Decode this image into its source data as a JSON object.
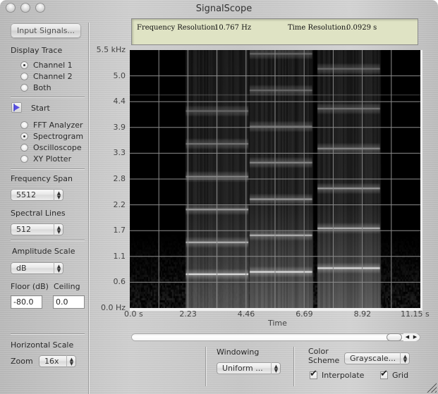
{
  "window": {
    "title": "SignalScope"
  },
  "sidebar": {
    "input_signals_button": "Input Signals...",
    "display_trace": {
      "label": "Display Trace",
      "options": [
        "Channel 1",
        "Channel 2",
        "Both"
      ],
      "selected": "Channel 1"
    },
    "start_button": "Start",
    "mode": {
      "options": [
        "FFT Analyzer",
        "Spectrogram",
        "Oscilloscope",
        "XY Plotter"
      ],
      "selected": "Spectrogram"
    },
    "frequency_span": {
      "label": "Frequency Span",
      "value": "5512"
    },
    "spectral_lines": {
      "label": "Spectral Lines",
      "value": "512"
    },
    "amplitude_scale": {
      "label": "Amplitude Scale",
      "value": "dB"
    },
    "floor": {
      "label": "Floor (dB)",
      "value": "-80.0"
    },
    "ceiling": {
      "label": "Ceiling",
      "value": "0.0"
    },
    "horizontal_scale": {
      "label": "Horizontal Scale",
      "zoom_label": "Zoom",
      "zoom_value": "16x"
    }
  },
  "readout": {
    "frequency_resolution_label": "Frequency Resolution:",
    "frequency_resolution_value": "10.767 Hz",
    "time_resolution_label": "Time Resolution:",
    "time_resolution_value": "0.0929 s"
  },
  "bottom": {
    "windowing": {
      "label": "Windowing",
      "value": "Uniform ..."
    },
    "color_scheme": {
      "label_line1": "Color",
      "label_line2": "Scheme",
      "value": "Grayscale..."
    },
    "interpolate": {
      "label": "Interpolate",
      "checked": true
    },
    "grid": {
      "label": "Grid",
      "checked": true
    },
    "scrollbar_position": 0.97
  },
  "chart_data": {
    "type": "heatmap",
    "title": "",
    "xlabel": "Time",
    "ylabel": "",
    "x_ticks": [
      "0.0 s",
      "2.23",
      "4.46",
      "6.69",
      "8.92",
      "11.15 s"
    ],
    "y_ticks": [
      "0.0 Hz",
      "0.6",
      "1.1",
      "1.7",
      "2.2",
      "2.8",
      "3.3",
      "3.9",
      "4.4",
      "5.0",
      "5.5 kHz"
    ],
    "xlim": [
      0,
      11.15
    ],
    "ylim_khz": [
      0,
      5.5
    ],
    "grid": true,
    "colormap": "grayscale",
    "tones": [
      {
        "t_start": 2.15,
        "t_end": 4.55,
        "fundamental_khz": 0.72,
        "harmonics_khz": [
          0.72,
          1.4,
          2.1,
          2.8,
          3.5,
          4.2
        ]
      },
      {
        "t_start": 4.6,
        "t_end": 7.0,
        "fundamental_khz": 0.77,
        "harmonics_khz": [
          0.77,
          1.55,
          2.32,
          3.1,
          3.87,
          4.64,
          5.42
        ]
      },
      {
        "t_start": 7.2,
        "t_end": 9.6,
        "fundamental_khz": 0.85,
        "harmonics_khz": [
          0.85,
          1.7,
          2.55,
          3.4,
          4.25,
          5.1
        ]
      }
    ],
    "faint_line_khz": 4.55
  }
}
